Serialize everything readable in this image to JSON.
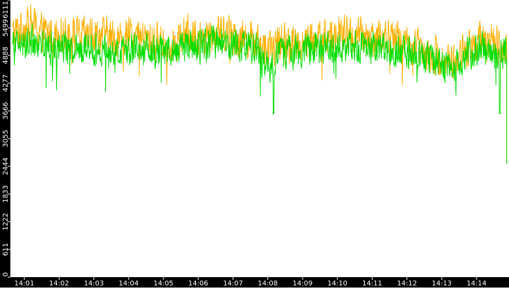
{
  "chart_data": {
    "type": "line",
    "title": "",
    "xlabel": "",
    "ylabel": "",
    "ylim": [
      0,
      6111
    ],
    "yticks": [
      0,
      611,
      1222,
      1833,
      2444,
      3055,
      3666,
      4277,
      4888,
      5499,
      6111
    ],
    "x_time_range": [
      "14:00:36",
      "14:14:56"
    ],
    "xticks": [
      "14:01",
      "14:02",
      "14:03",
      "14:04",
      "14:05",
      "14:06",
      "14:07",
      "14:08",
      "14:09",
      "14:10",
      "14:11",
      "14:12",
      "14:13",
      "14:14"
    ],
    "grid": false,
    "legend": "none",
    "series": [
      {
        "color": "#ffb000",
        "baseline": [
          [
            "14:00:40",
            5350
          ],
          [
            "14:01:10",
            5600
          ],
          [
            "14:01:40",
            5350
          ],
          [
            "14:02:10",
            5400
          ],
          [
            "14:02:40",
            5300
          ],
          [
            "14:03:10",
            5350
          ],
          [
            "14:03:40",
            5250
          ],
          [
            "14:04:10",
            5300
          ],
          [
            "14:04:40",
            5200
          ],
          [
            "14:05:10",
            5150
          ],
          [
            "14:05:40",
            5350
          ],
          [
            "14:06:10",
            5300
          ],
          [
            "14:06:40",
            5450
          ],
          [
            "14:07:10",
            5300
          ],
          [
            "14:07:40",
            5250
          ],
          [
            "14:08:00",
            4950
          ],
          [
            "14:08:20",
            5200
          ],
          [
            "14:08:40",
            5150
          ],
          [
            "14:09:10",
            5200
          ],
          [
            "14:09:40",
            5300
          ],
          [
            "14:10:10",
            5350
          ],
          [
            "14:10:40",
            5300
          ],
          [
            "14:11:10",
            5300
          ],
          [
            "14:11:40",
            5250
          ],
          [
            "14:12:10",
            5150
          ],
          [
            "14:12:40",
            4950
          ],
          [
            "14:13:00",
            4800
          ],
          [
            "14:13:20",
            4750
          ],
          [
            "14:13:40",
            5000
          ],
          [
            "14:14:00",
            5200
          ],
          [
            "14:14:30",
            5150
          ],
          [
            "14:14:52",
            5100
          ]
        ],
        "final_value": 2500
      },
      {
        "color": "#00dd00",
        "baseline": [
          [
            "14:00:40",
            5100
          ],
          [
            "14:01:10",
            5200
          ],
          [
            "14:01:40",
            5050
          ],
          [
            "14:02:10",
            5100
          ],
          [
            "14:02:40",
            5050
          ],
          [
            "14:03:10",
            5050
          ],
          [
            "14:03:40",
            5000
          ],
          [
            "14:04:10",
            5050
          ],
          [
            "14:04:40",
            5050
          ],
          [
            "14:05:10",
            4950
          ],
          [
            "14:05:40",
            5100
          ],
          [
            "14:06:10",
            5100
          ],
          [
            "14:06:40",
            5250
          ],
          [
            "14:07:10",
            5100
          ],
          [
            "14:07:40",
            5050
          ],
          [
            "14:08:00",
            4600
          ],
          [
            "14:08:20",
            4950
          ],
          [
            "14:08:40",
            4950
          ],
          [
            "14:09:10",
            5000
          ],
          [
            "14:09:40",
            5050
          ],
          [
            "14:10:10",
            5100
          ],
          [
            "14:10:40",
            5100
          ],
          [
            "14:11:10",
            5050
          ],
          [
            "14:11:40",
            5000
          ],
          [
            "14:12:10",
            4950
          ],
          [
            "14:12:40",
            4800
          ],
          [
            "14:13:00",
            4700
          ],
          [
            "14:13:20",
            4650
          ],
          [
            "14:13:40",
            4900
          ],
          [
            "14:14:00",
            5050
          ],
          [
            "14:14:30",
            4950
          ],
          [
            "14:14:52",
            4900
          ]
        ],
        "dips": [
          [
            "14:08:10",
            3600
          ],
          [
            "14:14:40",
            3600
          ]
        ],
        "final_value": 2500
      }
    ]
  }
}
